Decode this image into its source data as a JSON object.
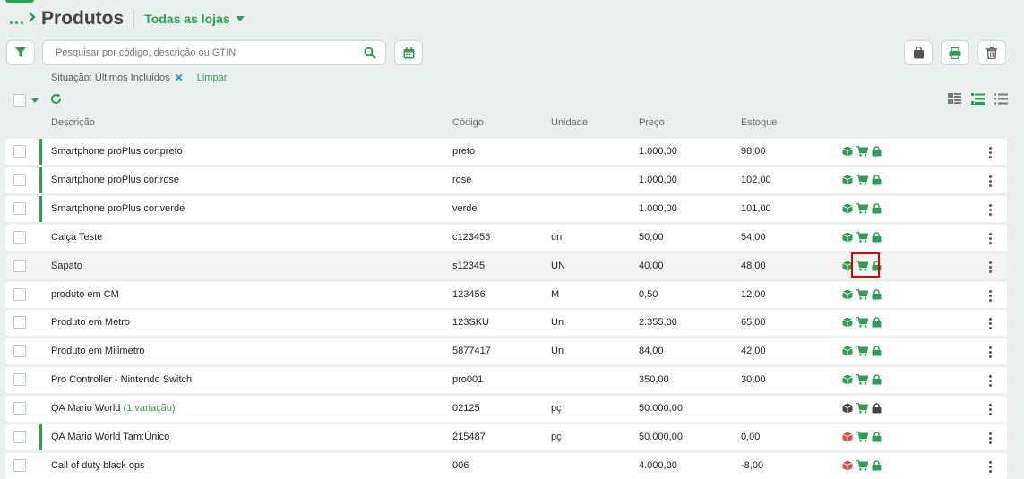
{
  "header": {
    "breadcrumb": "...",
    "title": "Produtos",
    "store_selector": "Todas as lojas"
  },
  "search": {
    "placeholder": "Pesquisar por código, descrição ou GTIN",
    "value": ""
  },
  "filters": {
    "situation": "Situação: Últimos Incluídos",
    "remove": "✕",
    "clear": "Limpar"
  },
  "columns": {
    "description": "Descrição",
    "code": "Código",
    "unit": "Unidade",
    "price": "Preço",
    "stock": "Estoque"
  },
  "colors": {
    "accent": "#2e9e52",
    "box_dark": "#444444",
    "box_red": "#d9534f",
    "highlight_border": "#e10000"
  },
  "rows": [
    {
      "description": "Smartphone proPlus cor:preto",
      "variation": "",
      "code": "preto",
      "unit": "",
      "price": "1.000,00",
      "stock": "98,00",
      "variant_bar": true,
      "box_color": "green",
      "lock_color": "green"
    },
    {
      "description": "Smartphone proPlus cor:rose",
      "variation": "",
      "code": "rose",
      "unit": "",
      "price": "1.000,00",
      "stock": "102,00",
      "variant_bar": true,
      "box_color": "green",
      "lock_color": "green"
    },
    {
      "description": "Smartphone proPlus cor:verde",
      "variation": "",
      "code": "verde",
      "unit": "",
      "price": "1.000,00",
      "stock": "101,00",
      "variant_bar": true,
      "box_color": "green",
      "lock_color": "green"
    },
    {
      "description": "Calça Teste",
      "variation": "",
      "code": "c123456",
      "unit": "un",
      "price": "50,00",
      "stock": "54,00",
      "variant_bar": false,
      "box_color": "green",
      "lock_color": "green"
    },
    {
      "description": "Sapato",
      "variation": "",
      "code": "s12345",
      "unit": "UN",
      "price": "40,00",
      "stock": "48,00",
      "variant_bar": false,
      "box_color": "green",
      "lock_color": "green",
      "highlighted": true
    },
    {
      "description": "produto em CM",
      "variation": "",
      "code": "123456",
      "unit": "M",
      "price": "0,50",
      "stock": "12,00",
      "variant_bar": false,
      "box_color": "green",
      "lock_color": "green"
    },
    {
      "description": "Produto em Metro",
      "variation": "",
      "code": "123SKU",
      "unit": "Un",
      "price": "2.355,00",
      "stock": "65,00",
      "variant_bar": false,
      "box_color": "green",
      "lock_color": "green"
    },
    {
      "description": "Produto em Milimetro",
      "variation": "",
      "code": "5877417",
      "unit": "Un",
      "price": "84,00",
      "stock": "42,00",
      "variant_bar": false,
      "box_color": "green",
      "lock_color": "green"
    },
    {
      "description": "Pro Controller - Nintendo Switch",
      "variation": "",
      "code": "pro001",
      "unit": "",
      "price": "350,00",
      "stock": "30,00",
      "variant_bar": false,
      "box_color": "green",
      "lock_color": "green"
    },
    {
      "description": "QA Mario World",
      "variation": "(1 variação)",
      "code": "02125",
      "unit": "pç",
      "price": "50.000,00",
      "stock": "",
      "variant_bar": false,
      "box_color": "dark",
      "lock_color": "dark"
    },
    {
      "description": "QA Mario World Tam:Único",
      "variation": "",
      "code": "215487",
      "unit": "pç",
      "price": "50.000,00",
      "stock": "0,00",
      "variant_bar": true,
      "box_color": "red",
      "lock_color": "green"
    },
    {
      "description": "Call of duty black ops",
      "variation": "",
      "code": "006",
      "unit": "",
      "price": "4.000,00",
      "stock": "-8,00",
      "variant_bar": false,
      "box_color": "red",
      "lock_color": "green"
    }
  ]
}
